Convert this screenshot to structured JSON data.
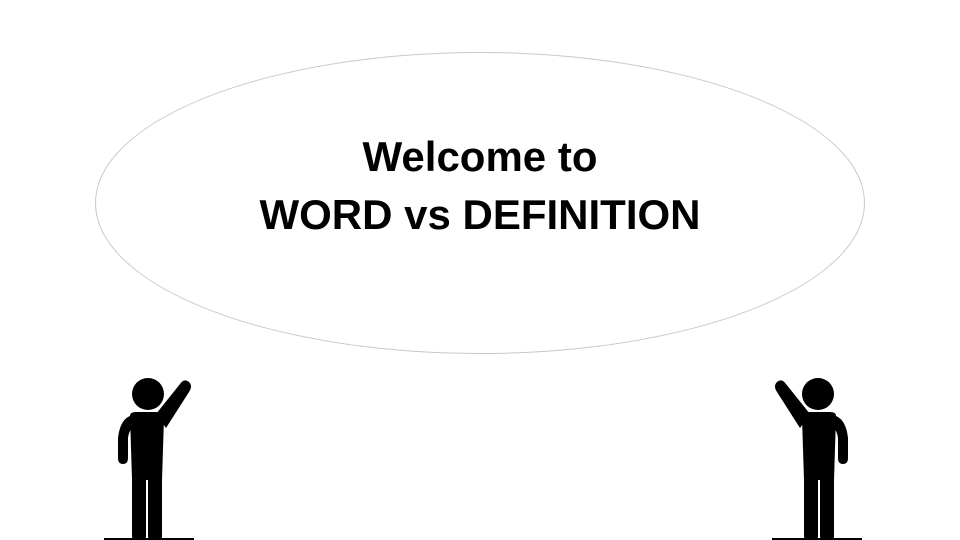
{
  "slide": {
    "title_line1": "Welcome to",
    "title_line2": "WORD vs DEFINITION"
  },
  "colors": {
    "background": "#ffffff",
    "figure": "#000000",
    "bubble_outline": "#c8c8c8"
  },
  "icons": {
    "left_figure": "person-waving-icon",
    "right_figure": "person-waving-icon"
  }
}
